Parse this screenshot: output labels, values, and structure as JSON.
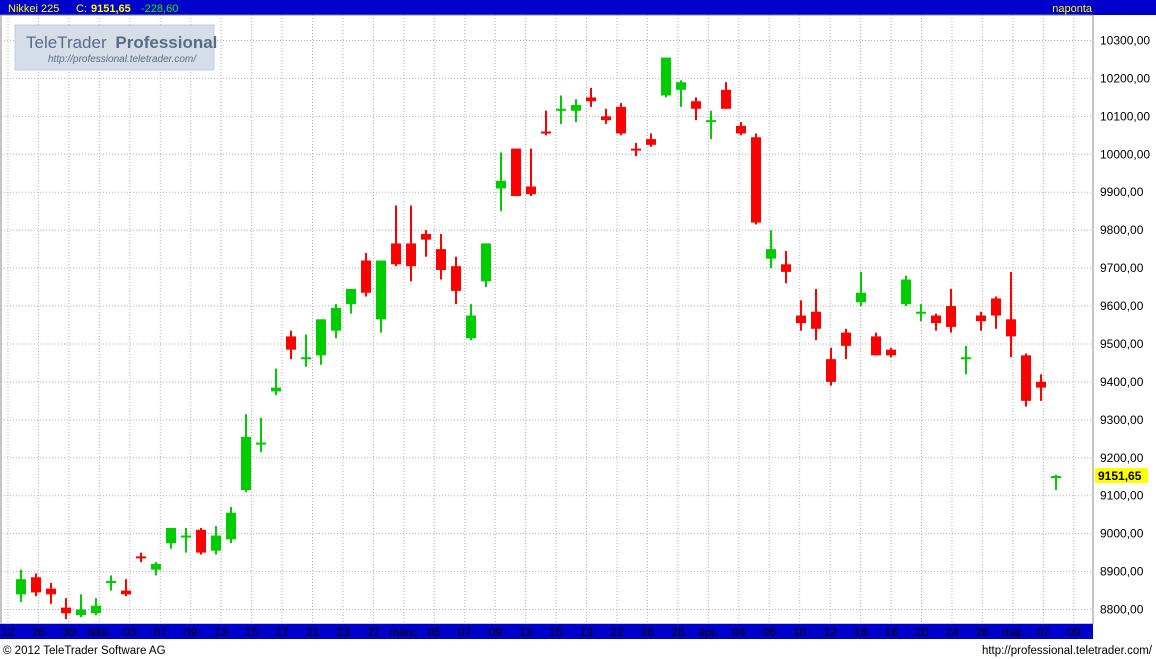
{
  "header": {
    "symbol": "Nikkei 225",
    "close_label": "C:",
    "close_value": "9151,65",
    "change": "-228,60",
    "interval": "naponta"
  },
  "watermark": {
    "brand_light": "TeleTrader",
    "brand_bold": "Professional",
    "url": "http://professional.teletrader.com/"
  },
  "footer": {
    "copyright": "© 2012 TeleTrader Software AG",
    "url": "http://professional.teletrader.com/"
  },
  "last_price_tag": "9151,65",
  "colors": {
    "header_bg": "#0000cc",
    "header_text": "#ffff00",
    "header_change": "#00ff00",
    "axis_bar_bg": "#0000cc",
    "up": "#00cc00",
    "down": "#ff0000",
    "grid": "#b0b0b0",
    "price_tag_bg": "#ffff00"
  },
  "chart_data": {
    "type": "candlestick",
    "title": "Nikkei 225",
    "ylim": [
      8760,
      10360
    ],
    "ytick_values": [
      8800,
      8900,
      9000,
      9100,
      9200,
      9300,
      9400,
      9500,
      9600,
      9700,
      9800,
      9900,
      10000,
      10100,
      10200,
      10300
    ],
    "ytick_labels": [
      "8800,00",
      "8900,00",
      "9000,00",
      "9100,00",
      "9200,00",
      "9300,00",
      "9400,00",
      "9500,00",
      "9600,00",
      "9700,00",
      "9800,00",
      "9900,00",
      "10000,00",
      "10100,00",
      "10200,00",
      "10300,00"
    ],
    "xtick_labels": [
      "12",
      "26",
      "30",
      "febr.",
      "03",
      "07",
      "09",
      "13",
      "15",
      "17",
      "21",
      "23",
      "27",
      "márc.",
      "05",
      "07",
      "09",
      "13",
      "15",
      "19",
      "22",
      "26",
      "28",
      "ápr.",
      "04",
      "06",
      "10",
      "12",
      "16",
      "18",
      "20",
      "24",
      "26",
      "máj.",
      "07",
      "09"
    ],
    "grid": true,
    "bars": [
      {
        "o": 8840,
        "h": 8905,
        "l": 8820,
        "c": 8880
      },
      {
        "o": 8885,
        "h": 8895,
        "l": 8835,
        "c": 8845
      },
      {
        "o": 8855,
        "h": 8870,
        "l": 8815,
        "c": 8840
      },
      {
        "o": 8805,
        "h": 8830,
        "l": 8775,
        "c": 8790
      },
      {
        "o": 8785,
        "h": 8840,
        "l": 8780,
        "c": 8800
      },
      {
        "o": 8790,
        "h": 8830,
        "l": 8785,
        "c": 8810
      },
      {
        "o": 8870,
        "h": 8890,
        "l": 8850,
        "c": 8875
      },
      {
        "o": 8850,
        "h": 8880,
        "l": 8835,
        "c": 8840
      },
      {
        "o": 8940,
        "h": 8950,
        "l": 8925,
        "c": 8935
      },
      {
        "o": 8905,
        "h": 8925,
        "l": 8890,
        "c": 8920
      },
      {
        "o": 8975,
        "h": 9015,
        "l": 8960,
        "c": 9015
      },
      {
        "o": 8990,
        "h": 9015,
        "l": 8950,
        "c": 8995
      },
      {
        "o": 9010,
        "h": 9015,
        "l": 8945,
        "c": 8950
      },
      {
        "o": 8955,
        "h": 9020,
        "l": 8945,
        "c": 8995
      },
      {
        "o": 8985,
        "h": 9070,
        "l": 8975,
        "c": 9055
      },
      {
        "o": 9115,
        "h": 9315,
        "l": 9110,
        "c": 9255
      },
      {
        "o": 9235,
        "h": 9305,
        "l": 9215,
        "c": 9240
      },
      {
        "o": 9375,
        "h": 9435,
        "l": 9365,
        "c": 9385
      },
      {
        "o": 9520,
        "h": 9535,
        "l": 9460,
        "c": 9485
      },
      {
        "o": 9465,
        "h": 9525,
        "l": 9440,
        "c": 9465
      },
      {
        "o": 9470,
        "h": 9565,
        "l": 9445,
        "c": 9565
      },
      {
        "o": 9535,
        "h": 9605,
        "l": 9515,
        "c": 9595
      },
      {
        "o": 9605,
        "h": 9645,
        "l": 9580,
        "c": 9645
      },
      {
        "o": 9720,
        "h": 9740,
        "l": 9625,
        "c": 9635
      },
      {
        "o": 9565,
        "h": 9720,
        "l": 9530,
        "c": 9720
      },
      {
        "o": 9765,
        "h": 9865,
        "l": 9705,
        "c": 9710
      },
      {
        "o": 9765,
        "h": 9865,
        "l": 9665,
        "c": 9705
      },
      {
        "o": 9790,
        "h": 9800,
        "l": 9730,
        "c": 9775
      },
      {
        "o": 9750,
        "h": 9790,
        "l": 9670,
        "c": 9695
      },
      {
        "o": 9705,
        "h": 9730,
        "l": 9605,
        "c": 9640
      },
      {
        "o": 9515,
        "h": 9605,
        "l": 9510,
        "c": 9575
      },
      {
        "o": 9665,
        "h": 9765,
        "l": 9650,
        "c": 9765
      },
      {
        "o": 9910,
        "h": 10005,
        "l": 9850,
        "c": 9930
      },
      {
        "o": 10015,
        "h": 10015,
        "l": 9890,
        "c": 9890
      },
      {
        "o": 9915,
        "h": 10015,
        "l": 9890,
        "c": 9895
      },
      {
        "o": 10060,
        "h": 10115,
        "l": 10050,
        "c": 10055
      },
      {
        "o": 10115,
        "h": 10155,
        "l": 10080,
        "c": 10120
      },
      {
        "o": 10115,
        "h": 10145,
        "l": 10085,
        "c": 10130
      },
      {
        "o": 10150,
        "h": 10175,
        "l": 10125,
        "c": 10140
      },
      {
        "o": 10100,
        "h": 10120,
        "l": 10080,
        "c": 10090
      },
      {
        "o": 10125,
        "h": 10135,
        "l": 10050,
        "c": 10055
      },
      {
        "o": 10015,
        "h": 10030,
        "l": 9995,
        "c": 10010
      },
      {
        "o": 10040,
        "h": 10055,
        "l": 10020,
        "c": 10025
      },
      {
        "o": 10155,
        "h": 10255,
        "l": 10150,
        "c": 10255
      },
      {
        "o": 10170,
        "h": 10195,
        "l": 10125,
        "c": 10190
      },
      {
        "o": 10140,
        "h": 10150,
        "l": 10090,
        "c": 10120
      },
      {
        "o": 10090,
        "h": 10115,
        "l": 10040,
        "c": 10090
      },
      {
        "o": 10170,
        "h": 10190,
        "l": 10120,
        "c": 10120
      },
      {
        "o": 10075,
        "h": 10085,
        "l": 10050,
        "c": 10055
      },
      {
        "o": 10045,
        "h": 10055,
        "l": 9815,
        "c": 9820
      },
      {
        "o": 9725,
        "h": 9800,
        "l": 9700,
        "c": 9750
      },
      {
        "o": 9710,
        "h": 9745,
        "l": 9660,
        "c": 9690
      },
      {
        "o": 9575,
        "h": 9615,
        "l": 9535,
        "c": 9555
      },
      {
        "o": 9585,
        "h": 9645,
        "l": 9510,
        "c": 9540
      },
      {
        "o": 9460,
        "h": 9490,
        "l": 9390,
        "c": 9400
      },
      {
        "o": 9530,
        "h": 9540,
        "l": 9460,
        "c": 9495
      },
      {
        "o": 9610,
        "h": 9690,
        "l": 9600,
        "c": 9635
      },
      {
        "o": 9520,
        "h": 9530,
        "l": 9470,
        "c": 9470
      },
      {
        "o": 9485,
        "h": 9490,
        "l": 9465,
        "c": 9470
      },
      {
        "o": 9605,
        "h": 9680,
        "l": 9600,
        "c": 9670
      },
      {
        "o": 9585,
        "h": 9605,
        "l": 9560,
        "c": 9585
      },
      {
        "o": 9575,
        "h": 9580,
        "l": 9535,
        "c": 9555
      },
      {
        "o": 9600,
        "h": 9645,
        "l": 9530,
        "c": 9545
      },
      {
        "o": 9465,
        "h": 9495,
        "l": 9420,
        "c": 9465
      },
      {
        "o": 9575,
        "h": 9585,
        "l": 9535,
        "c": 9560
      },
      {
        "o": 9620,
        "h": 9625,
        "l": 9540,
        "c": 9575
      },
      {
        "o": 9565,
        "h": 9690,
        "l": 9465,
        "c": 9520
      },
      {
        "o": 9470,
        "h": 9475,
        "l": 9335,
        "c": 9350
      },
      {
        "o": 9400,
        "h": 9420,
        "l": 9350,
        "c": 9385
      },
      {
        "o": 9150,
        "h": 9155,
        "l": 9115,
        "c": 9152
      }
    ]
  }
}
